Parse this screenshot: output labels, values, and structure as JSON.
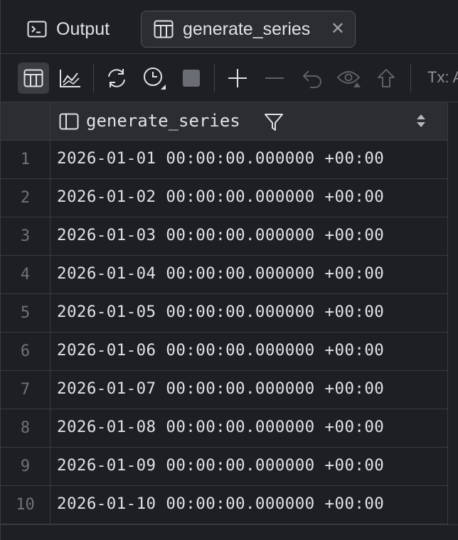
{
  "tabs": [
    {
      "label": "Output",
      "icon": "console-icon",
      "active": false
    },
    {
      "label": "generate_series",
      "icon": "table-icon",
      "active": true
    }
  ],
  "toolbar": {
    "tx_label": "Tx: A",
    "buttons": [
      "table-view-icon",
      "chart-view-icon",
      "refresh-icon",
      "history-icon",
      "stop-icon",
      "add-row-icon",
      "delete-row-icon",
      "revert-icon",
      "preview-pending-icon",
      "submit-icon"
    ]
  },
  "grid": {
    "column": "generate_series",
    "rows": [
      {
        "n": "1",
        "value": "2026-01-01 00:00:00.000000 +00:00"
      },
      {
        "n": "2",
        "value": "2026-01-02 00:00:00.000000 +00:00"
      },
      {
        "n": "3",
        "value": "2026-01-03 00:00:00.000000 +00:00"
      },
      {
        "n": "4",
        "value": "2026-01-04 00:00:00.000000 +00:00"
      },
      {
        "n": "5",
        "value": "2026-01-05 00:00:00.000000 +00:00"
      },
      {
        "n": "6",
        "value": "2026-01-06 00:00:00.000000 +00:00"
      },
      {
        "n": "7",
        "value": "2026-01-07 00:00:00.000000 +00:00"
      },
      {
        "n": "8",
        "value": "2026-01-08 00:00:00.000000 +00:00"
      },
      {
        "n": "9",
        "value": "2026-01-09 00:00:00.000000 +00:00"
      },
      {
        "n": "10",
        "value": "2026-01-10 00:00:00.000000 +00:00"
      }
    ]
  },
  "colors": {
    "background": "#1e1f22",
    "header": "#2b2d30",
    "border": "#393b40",
    "text": "#dfe1e5",
    "muted": "#6f737a"
  }
}
